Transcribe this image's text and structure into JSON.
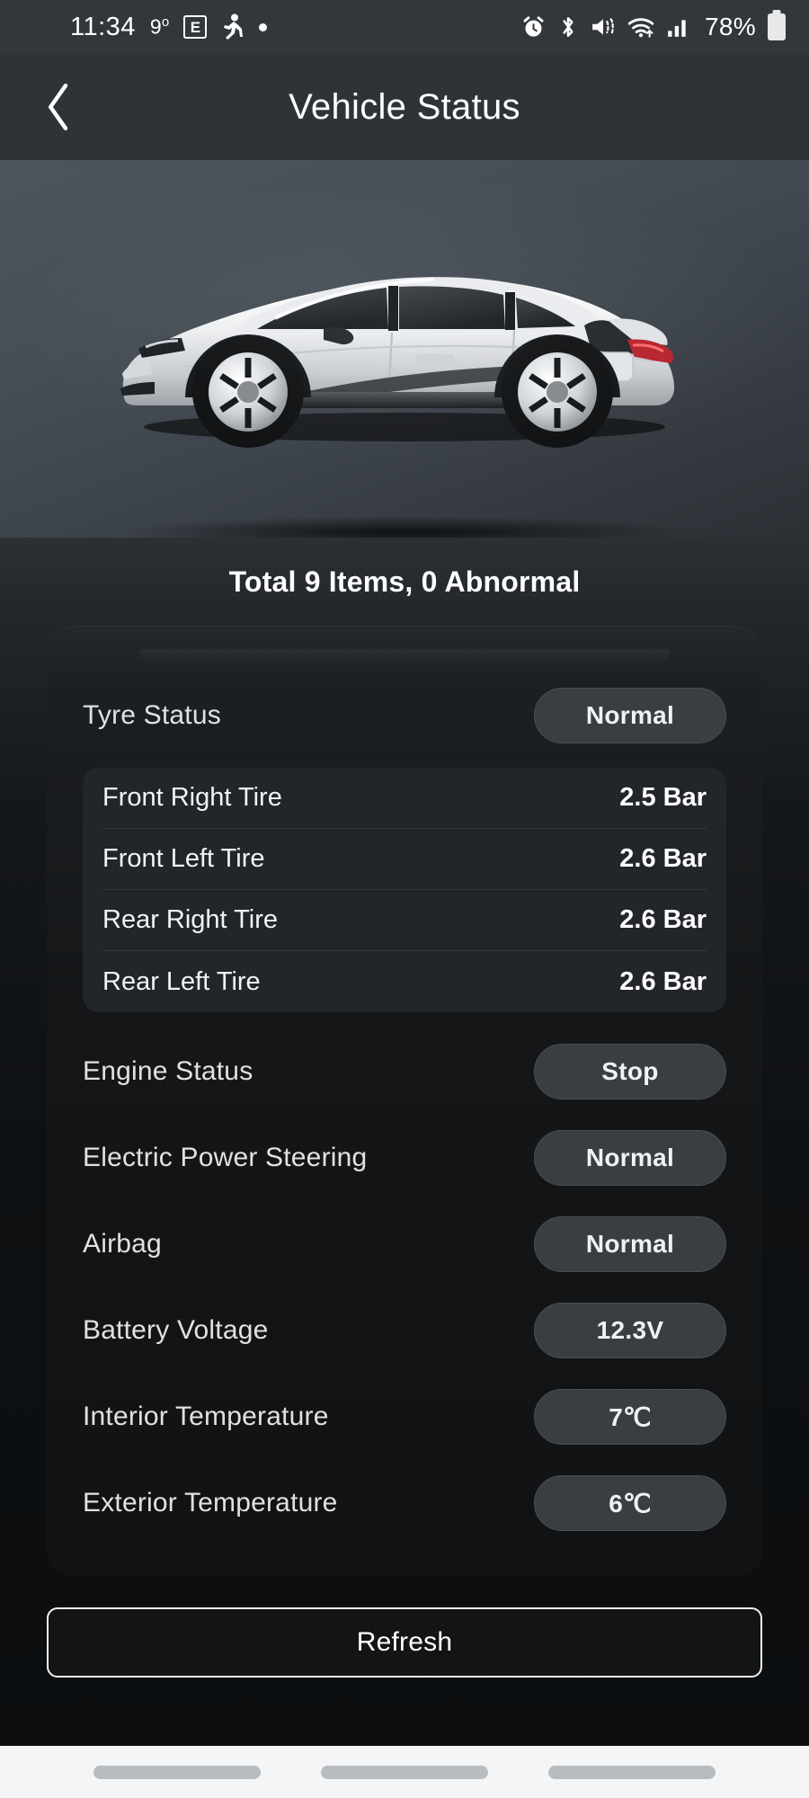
{
  "statusbar": {
    "time": "11:34",
    "temperature": "9",
    "degree": "o",
    "app_badge": "E",
    "icons": [
      "running-person-icon",
      "dot-icon",
      "alarm-icon",
      "bluetooth-icon",
      "mute-icon",
      "wifi-icon",
      "signal-icon"
    ],
    "battery_percent": "78%"
  },
  "appbar": {
    "title": "Vehicle Status",
    "back_label": "Back"
  },
  "hero": {
    "vehicle_alt": "silver hatchback side view"
  },
  "summary": {
    "text": "Total 9 Items, 0 Abnormal",
    "total_items": 9,
    "abnormal": 0
  },
  "sections": {
    "tyre": {
      "label": "Tyre Status",
      "status": "Normal",
      "tires": [
        {
          "name": "Front Right Tire",
          "value": "2.5 Bar"
        },
        {
          "name": "Front Left Tire",
          "value": "2.6 Bar"
        },
        {
          "name": "Rear Right Tire",
          "value": "2.6 Bar"
        },
        {
          "name": "Rear Left Tire",
          "value": "2.6 Bar"
        }
      ]
    },
    "items": [
      {
        "label": "Engine Status",
        "value": "Stop"
      },
      {
        "label": "Electric Power Steering",
        "value": "Normal"
      },
      {
        "label": "Airbag",
        "value": "Normal"
      },
      {
        "label": "Battery Voltage",
        "value": "12.3V"
      },
      {
        "label": "Interior Temperature",
        "value": "7℃"
      },
      {
        "label": "Exterior Temperature",
        "value": "6℃"
      }
    ]
  },
  "actions": {
    "refresh_label": "Refresh"
  },
  "colors": {
    "statusbar_bg": "#32373b",
    "appbar_bg": "#2e3338",
    "hero_bg": "#464e56",
    "card_bg": "#15181b",
    "pill_bg": "#3a3e42",
    "text_primary": "#ffffff",
    "text_secondary": "#dfe1e3",
    "navbar_bg": "#f4f5f7"
  }
}
